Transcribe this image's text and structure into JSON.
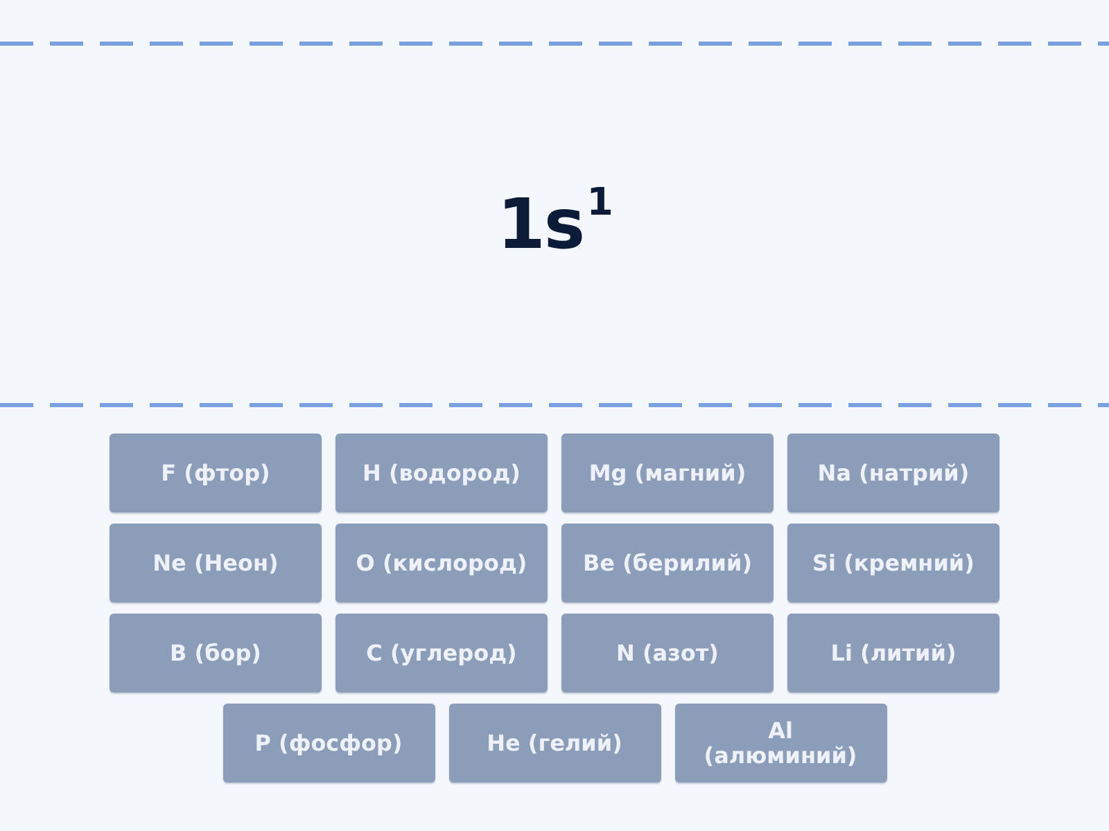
{
  "formula": {
    "text": "1s$^{1}$"
  },
  "options": [
    {
      "label": "F (фтор)",
      "disabled": true
    },
    {
      "label": "H (водород)",
      "disabled": true
    },
    {
      "label": "Mg (магний)",
      "disabled": true
    },
    {
      "label": "Na (натрий)",
      "disabled": true
    },
    {
      "label": "Ne (Неон)",
      "disabled": true
    },
    {
      "label": "O (кислород)",
      "disabled": true
    },
    {
      "label": "Be (берилий)",
      "disabled": true
    },
    {
      "label": "Si (кремний)",
      "disabled": true
    },
    {
      "label": "B (бор)",
      "disabled": true
    },
    {
      "label": "C (углерод)",
      "disabled": true
    },
    {
      "label": "N (азот)",
      "disabled": true
    },
    {
      "label": "Li (литий)",
      "disabled": true
    },
    {
      "label": "P (фосфор)",
      "disabled": true
    },
    {
      "label": "He (гелий)",
      "disabled": true
    },
    {
      "label": "Al (алюминий)",
      "disabled": true
    }
  ]
}
